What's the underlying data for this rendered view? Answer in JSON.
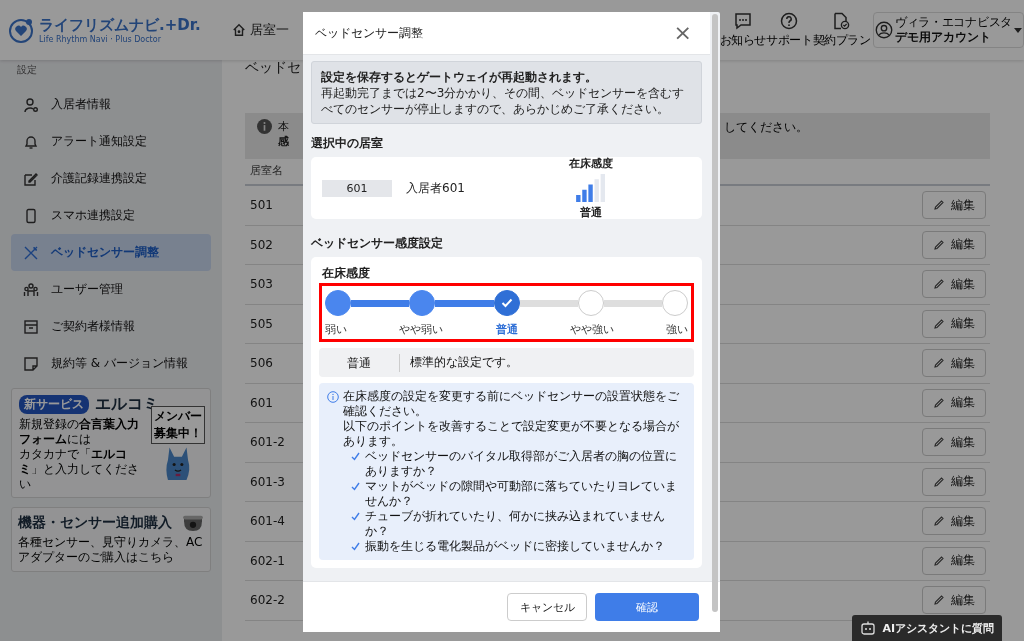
{
  "header": {
    "logo_title": "ライフリズムナビ.+Dr.",
    "logo_subtitle": "Life Rhythm Navi · Plus Doctor",
    "nav_link": "居室一",
    "icons": [
      {
        "label": "お知らせ",
        "kind": "chat"
      },
      {
        "label": "サポート",
        "kind": "help"
      },
      {
        "label": "契約プラン",
        "kind": "plan"
      }
    ],
    "account": {
      "facility": "ヴィラ・エコナビスタ",
      "name": "デモ用アカウント"
    }
  },
  "sidebar": {
    "section": "設定",
    "items": [
      {
        "label": "入居者情報",
        "kind": "person",
        "selected": false
      },
      {
        "label": "アラート通知設定",
        "kind": "bell",
        "selected": false
      },
      {
        "label": "介護記録連携設定",
        "kind": "edit",
        "selected": false
      },
      {
        "label": "スマホ連携設定",
        "kind": "phone",
        "selected": false
      },
      {
        "label": "ベッドセンサー調整",
        "kind": "tools",
        "selected": true
      },
      {
        "label": "ユーザー管理",
        "kind": "users",
        "selected": false
      },
      {
        "label": "ご契約者様情報",
        "kind": "archive",
        "selected": false
      },
      {
        "label": "規約等 & バージョン情報",
        "kind": "note",
        "selected": false
      }
    ],
    "promo": {
      "badge": "新サービス",
      "title": "エルコミ",
      "text_1": "新規登録の**合言葉入力フォーム**には",
      "text_2": "カタカナで「**エルコミ**」と入力してください",
      "sign_lines": [
        "メンバー",
        "募集中！"
      ]
    },
    "purchase": {
      "title": "機器・センサー追加購入",
      "subtitle": "各種センサー、見守りカメラ、ACアダプターのご購入はこちら"
    }
  },
  "main": {
    "heading": "ベッドセ",
    "notice": {
      "left_lines": [
        "本",
        "感"
      ],
      "right": "してください。"
    },
    "table": {
      "columns": [
        "居室名"
      ],
      "rows": [
        {
          "room": "501",
          "action": "編集"
        },
        {
          "room": "502",
          "action": "編集"
        },
        {
          "room": "503",
          "action": "編集"
        },
        {
          "room": "505",
          "action": "編集"
        },
        {
          "room": "506",
          "action": "編集"
        },
        {
          "room": "601",
          "action": "編集"
        },
        {
          "room": "601-2",
          "action": "編集"
        },
        {
          "room": "601-3",
          "action": "編集"
        },
        {
          "room": "601-4",
          "action": "編集"
        },
        {
          "room": "602-1",
          "action": "編集"
        },
        {
          "room": "602-2",
          "action": "編集"
        }
      ]
    }
  },
  "ai_button": "AIアシスタントに質問",
  "modal": {
    "title": "ベッドセンサー調整",
    "close": "×",
    "warning": {
      "title": "設定を保存するとゲートウェイが再起動されます。",
      "text": "再起動完了までは2〜3分かかり、その間、ベッドセンサーを含むすべてのセンサーが停止しますので、あらかじめご了承ください。"
    },
    "selected_room": {
      "heading": "選択中の居室",
      "room": "601",
      "resident": "入居者601",
      "sensitivity_label": "在床感度",
      "sensitivity_value": "普通"
    },
    "settings": {
      "heading": "ベッドセンサー感度設定",
      "label": "在床感度",
      "highlighted": true,
      "steps": [
        {
          "label": "弱い",
          "selected": false
        },
        {
          "label": "やや弱い",
          "selected": false
        },
        {
          "label": "普通",
          "selected": true
        },
        {
          "label": "やや強い",
          "selected": false
        },
        {
          "label": "強い",
          "selected": false
        }
      ],
      "description": {
        "name": "普通",
        "text": "標準的な設定です。"
      },
      "tips": {
        "lines": [
          "在床感度の設定を変更する前にベッドセンサーの設置状態をご確認ください。",
          "以下のポイントを改善することで設定変更が不要となる場合があります。"
        ],
        "checks": [
          "ベッドセンサーのバイタル取得部がご入居者の胸の位置にありますか？",
          "マットがベッドの隙間や可動部に落ちていたりヨレていませんか？",
          "チューブが折れていたり、何かに挟み込まれていませんか？",
          "振動を生じる電化製品がベッドに密接していませんか？"
        ]
      }
    },
    "buttons": {
      "cancel": "キャンセル",
      "confirm": "確認"
    }
  }
}
